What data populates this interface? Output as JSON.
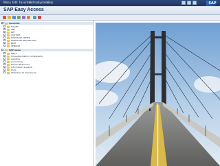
{
  "menubar": {
    "items": [
      "Menu",
      "Edit",
      "Favorites",
      "Extras",
      "System",
      "Help"
    ],
    "sap_logo": "SAP"
  },
  "header": {
    "title": "SAP Easy Access",
    "subtitle": ""
  },
  "tree": {
    "favorites_label": "Favorites",
    "favorites": [
      "FLIGHT",
      "ABC",
      "DEF",
      "CUSTOM",
      "PURCHASE ORDER",
      "PURCHASE REQUISITION",
      "BOM",
      "VENDOR"
    ],
    "sap_menu_label": "SAP menu",
    "sap_menu": [
      "Office",
      "Cross-Application Components",
      "Logistics",
      "Accounting",
      "Human Resources",
      "Information Systems",
      "Tools",
      "WebClient UI Framework"
    ]
  },
  "colors": {
    "menubar": "#1f3563",
    "titlebar": "#e1e8f2",
    "folder": "#e6c35a"
  },
  "image": {
    "subject": "cable-stayed bridge photograph"
  }
}
